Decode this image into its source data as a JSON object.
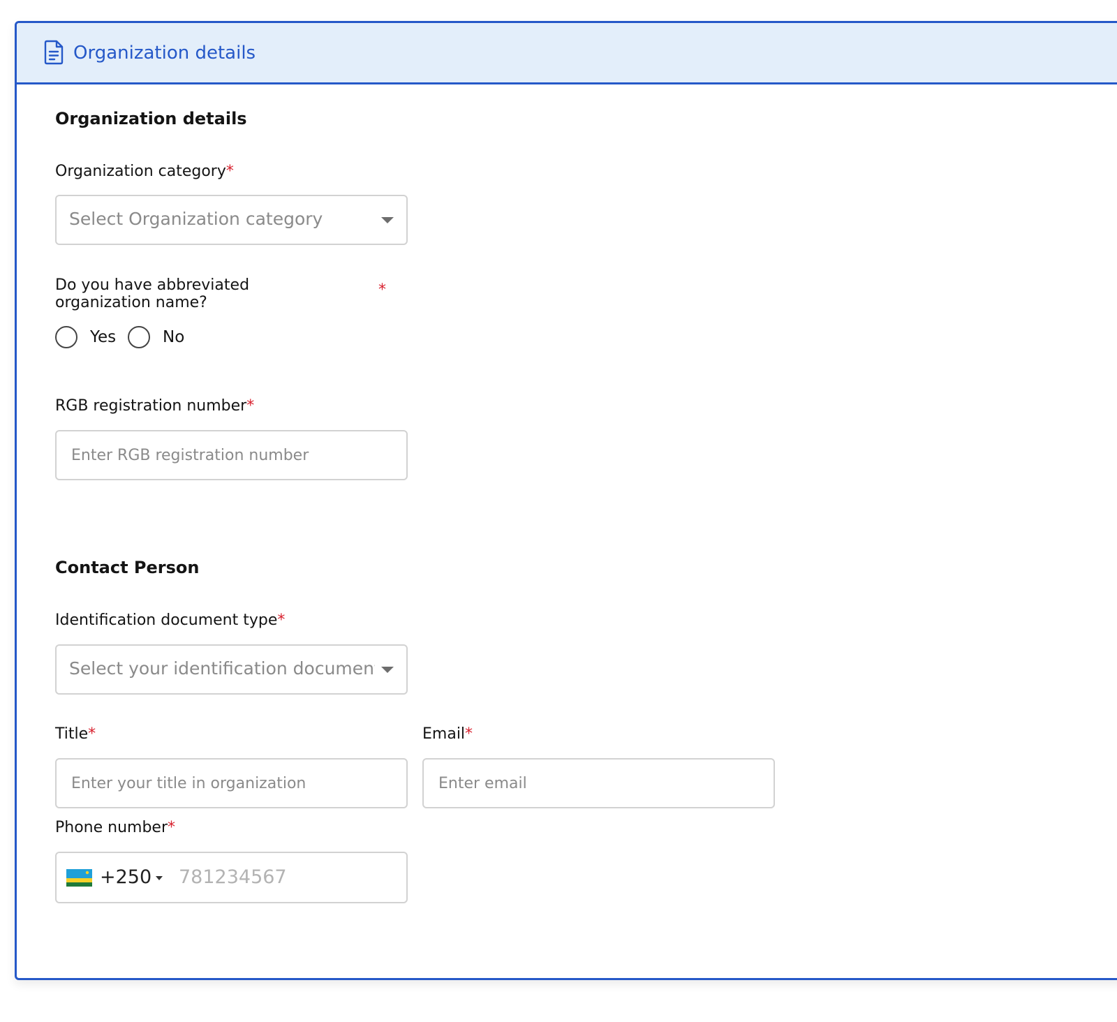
{
  "header": {
    "title": "Organization details",
    "icon": "document-icon",
    "accent_color": "#2558c8",
    "background_color": "#e3eefa"
  },
  "organization": {
    "section_title": "Organization details",
    "category": {
      "label": "Organization category",
      "required_mark": "*",
      "placeholder": "Select Organization category"
    },
    "abbreviated_name": {
      "label": "Do you have abbreviated organization name?",
      "required_mark": "*",
      "options": [
        "Yes",
        "No"
      ],
      "selected": null
    },
    "rgb_number": {
      "label": "RGB registration number",
      "required_mark": "*",
      "placeholder": "Enter RGB registration number",
      "value": ""
    }
  },
  "contact": {
    "section_title": "Contact Person",
    "id_doc_type": {
      "label": "Identification document type",
      "required_mark": "*",
      "placeholder": "Select your identification document type"
    },
    "title": {
      "label": "Title",
      "required_mark": "*",
      "placeholder": "Enter your title in organization",
      "value": ""
    },
    "email": {
      "label": "Email",
      "required_mark": "*",
      "placeholder": "Enter email",
      "value": ""
    },
    "phone": {
      "label": "Phone number",
      "required_mark": "*",
      "country_flag": "rwanda-flag-icon",
      "dial_code": "+250",
      "placeholder": "781234567"
    }
  }
}
